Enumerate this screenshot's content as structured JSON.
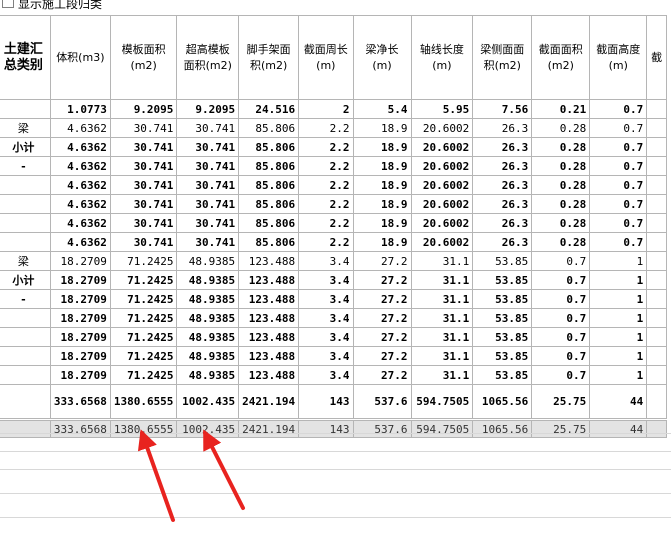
{
  "toolbar": {
    "checkbox_label": "显示施工段归类"
  },
  "headers": [
    "土建汇总类别",
    "体积(m3)",
    "模板面积(m2)",
    "超高模板面积(m2)",
    "脚手架面积(m2)",
    "截面周长(m)",
    "梁净长(m)",
    "轴线长度(m)",
    "梁侧面面积(m2)",
    "截面面积(m2)",
    "截面高度(m)",
    "截"
  ],
  "rows": [
    {
      "style": "bold",
      "cells": [
        "",
        "1.0773",
        "9.2095",
        "9.2095",
        "24.516",
        "2",
        "5.4",
        "5.95",
        "7.56",
        "0.21",
        "0.7"
      ]
    },
    {
      "style": "plain",
      "cells": [
        "梁",
        "4.6362",
        "30.741",
        "30.741",
        "85.806",
        "2.2",
        "18.9",
        "20.6002",
        "26.3",
        "0.28",
        "0.7"
      ]
    },
    {
      "style": "bold",
      "cells": [
        "小计",
        "4.6362",
        "30.741",
        "30.741",
        "85.806",
        "2.2",
        "18.9",
        "20.6002",
        "26.3",
        "0.28",
        "0.7"
      ]
    },
    {
      "style": "bold",
      "cells": [
        "-",
        "4.6362",
        "30.741",
        "30.741",
        "85.806",
        "2.2",
        "18.9",
        "20.6002",
        "26.3",
        "0.28",
        "0.7"
      ]
    },
    {
      "style": "bold",
      "cells": [
        "",
        "4.6362",
        "30.741",
        "30.741",
        "85.806",
        "2.2",
        "18.9",
        "20.6002",
        "26.3",
        "0.28",
        "0.7"
      ]
    },
    {
      "style": "bold",
      "cells": [
        "",
        "4.6362",
        "30.741",
        "30.741",
        "85.806",
        "2.2",
        "18.9",
        "20.6002",
        "26.3",
        "0.28",
        "0.7"
      ]
    },
    {
      "style": "bold",
      "cells": [
        "",
        "4.6362",
        "30.741",
        "30.741",
        "85.806",
        "2.2",
        "18.9",
        "20.6002",
        "26.3",
        "0.28",
        "0.7"
      ]
    },
    {
      "style": "bold",
      "cells": [
        "",
        "4.6362",
        "30.741",
        "30.741",
        "85.806",
        "2.2",
        "18.9",
        "20.6002",
        "26.3",
        "0.28",
        "0.7"
      ]
    },
    {
      "style": "plain",
      "cells": [
        "梁",
        "18.2709",
        "71.2425",
        "48.9385",
        "123.488",
        "3.4",
        "27.2",
        "31.1",
        "53.85",
        "0.7",
        "1"
      ]
    },
    {
      "style": "bold",
      "cells": [
        "小计",
        "18.2709",
        "71.2425",
        "48.9385",
        "123.488",
        "3.4",
        "27.2",
        "31.1",
        "53.85",
        "0.7",
        "1"
      ]
    },
    {
      "style": "bold",
      "cells": [
        "-",
        "18.2709",
        "71.2425",
        "48.9385",
        "123.488",
        "3.4",
        "27.2",
        "31.1",
        "53.85",
        "0.7",
        "1"
      ]
    },
    {
      "style": "bold",
      "cells": [
        "",
        "18.2709",
        "71.2425",
        "48.9385",
        "123.488",
        "3.4",
        "27.2",
        "31.1",
        "53.85",
        "0.7",
        "1"
      ]
    },
    {
      "style": "bold",
      "cells": [
        "",
        "18.2709",
        "71.2425",
        "48.9385",
        "123.488",
        "3.4",
        "27.2",
        "31.1",
        "53.85",
        "0.7",
        "1"
      ]
    },
    {
      "style": "bold",
      "cells": [
        "",
        "18.2709",
        "71.2425",
        "48.9385",
        "123.488",
        "3.4",
        "27.2",
        "31.1",
        "53.85",
        "0.7",
        "1"
      ]
    },
    {
      "style": "bold",
      "cells": [
        "",
        "18.2709",
        "71.2425",
        "48.9385",
        "123.488",
        "3.4",
        "27.2",
        "31.1",
        "53.85",
        "0.7",
        "1"
      ]
    },
    {
      "style": "total",
      "cells": [
        "",
        "333.6568",
        "1380.6555",
        "1002.435",
        "2421.194",
        "143",
        "537.6",
        "594.7505",
        "1065.56",
        "25.75",
        "44"
      ]
    },
    {
      "style": "footer",
      "cells": [
        "",
        "333.6568",
        "1380.6555",
        "1002.435",
        "2421.194",
        "143",
        "537.6",
        "594.7505",
        "1065.56",
        "25.75",
        "44"
      ]
    }
  ],
  "annotation_color": "#e8231f"
}
